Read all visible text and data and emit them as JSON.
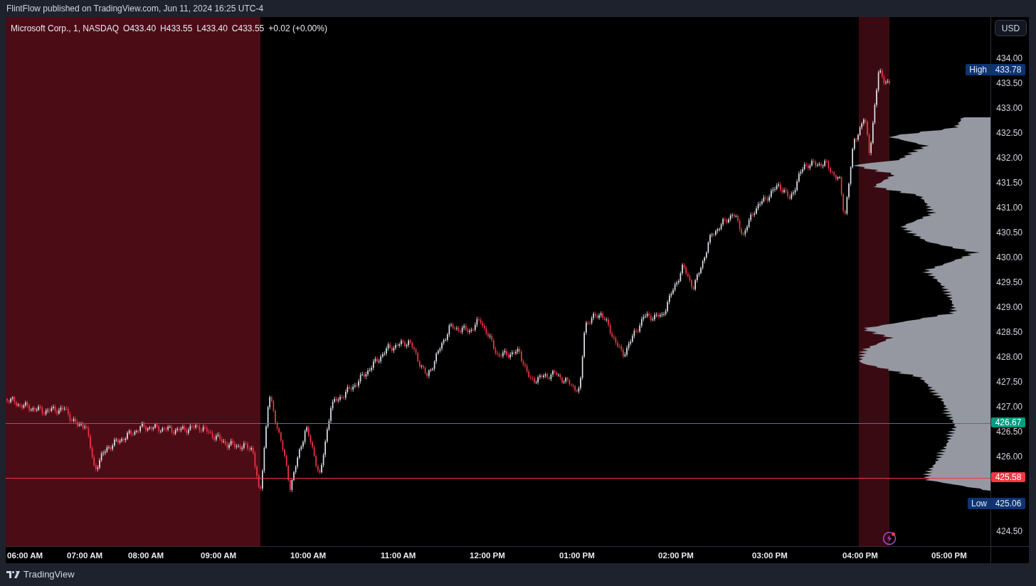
{
  "header": {
    "publisher_line": "FlintFlow published on TradingView.com, Jun 11, 2024 16:25 UTC-4"
  },
  "legend": {
    "symbol": "Microsoft Corp., 1, NASDAQ",
    "values": [
      "O433.40",
      "H433.55",
      "L433.40",
      "C433.55",
      "+0.02 (+0.00%)"
    ]
  },
  "currency_button": "USD",
  "price_axis": {
    "ticks": [
      "434.00",
      "433.50",
      "433.00",
      "432.50",
      "432.00",
      "431.50",
      "431.00",
      "430.50",
      "430.00",
      "429.50",
      "429.00",
      "428.50",
      "428.00",
      "427.50",
      "427.00",
      "426.50",
      "426.00",
      "424.50"
    ]
  },
  "price_markers": [
    {
      "kind": "tag",
      "label": "High",
      "value": "433.78"
    },
    {
      "kind": "line",
      "value": "426.67",
      "color": "#089981"
    },
    {
      "kind": "line",
      "value": "425.58",
      "color": "#f23645"
    },
    {
      "kind": "tag",
      "label": "Low",
      "value": "425.06"
    }
  ],
  "time_axis": {
    "ticks": [
      "06:00 AM",
      "07:00 AM",
      "08:00 AM",
      "09:00 AM",
      "10:00 AM",
      "11:00 AM",
      "12:00 PM",
      "01:00 PM",
      "02:00 PM",
      "03:00 PM",
      "04:00 PM",
      "05:00 PM"
    ]
  },
  "footer": {
    "brand": "TradingView"
  }
}
